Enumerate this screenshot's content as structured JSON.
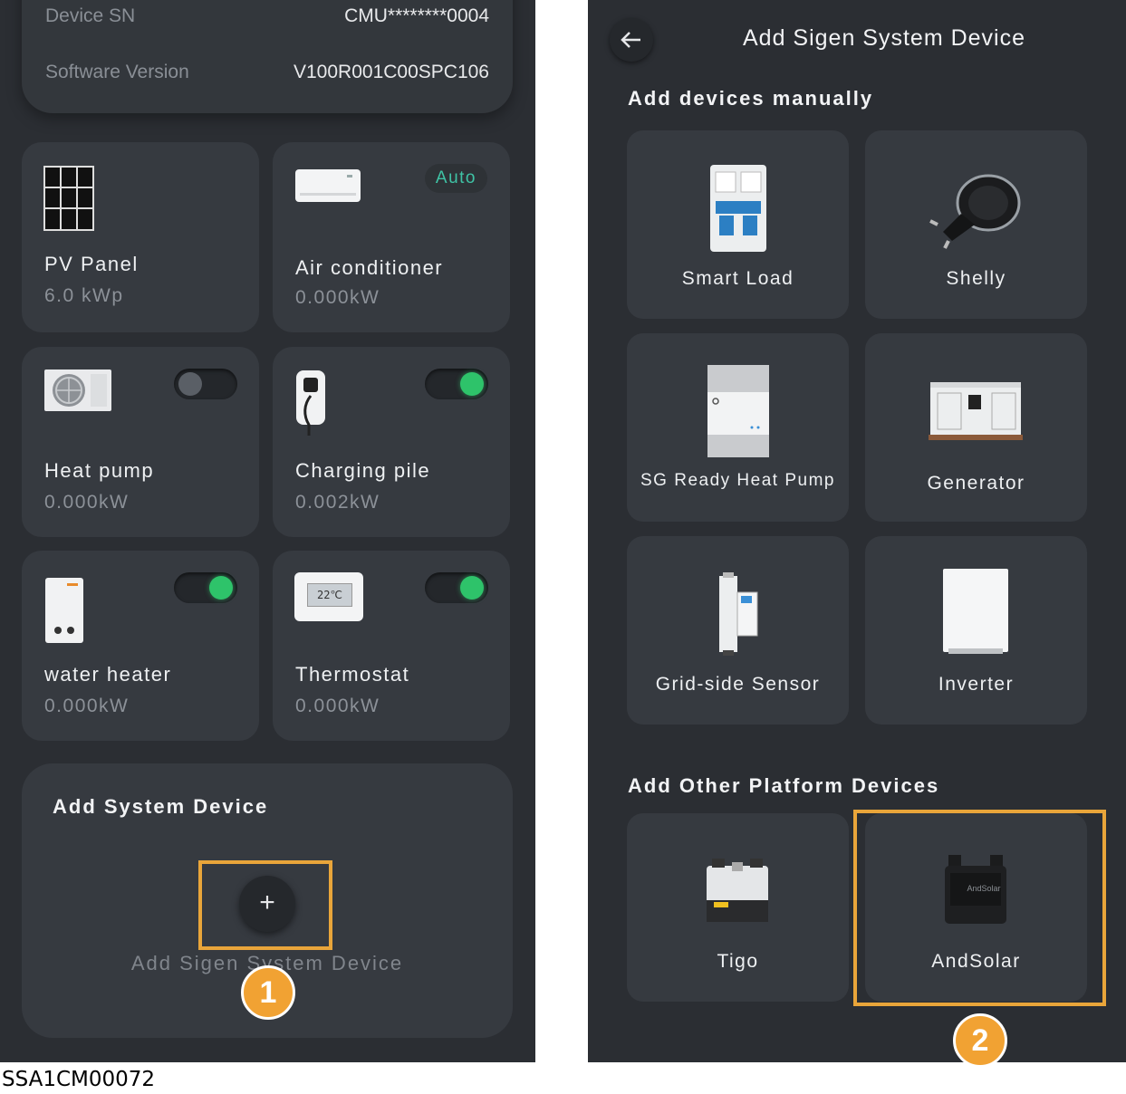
{
  "left_screen": {
    "info": {
      "device_sn_label": "Device SN",
      "device_sn_value": "CMU********0004",
      "software_version_label": "Software Version",
      "software_version_value": "V100R001C00SPC106"
    },
    "devices": [
      {
        "name": "PV Panel",
        "value": "6.0 kWp",
        "icon": "pv-panel-icon"
      },
      {
        "name": "Air conditioner",
        "value": "0.000kW",
        "icon": "air-conditioner-icon",
        "badge": "Auto"
      },
      {
        "name": "Heat pump",
        "value": "0.000kW",
        "icon": "heat-pump-icon",
        "toggle": false
      },
      {
        "name": "Charging pile",
        "value": "0.002kW",
        "icon": "charging-pile-icon",
        "toggle": true
      },
      {
        "name": "water heater",
        "value": "0.000kW",
        "icon": "water-heater-icon",
        "toggle": true
      },
      {
        "name": "Thermostat",
        "value": "0.000kW",
        "icon": "thermostat-icon",
        "toggle": true,
        "display": "22℃"
      }
    ],
    "add_section": {
      "title": "Add System Device",
      "button_symbol": "+",
      "button_label": "Add Sigen System Device"
    },
    "step_number": "1"
  },
  "right_screen": {
    "header_title": "Add Sigen System Device",
    "back_icon": "arrow-left-icon",
    "manual_title": "Add devices manually",
    "manual_devices": [
      {
        "label": "Smart Load",
        "icon": "smart-load-icon"
      },
      {
        "label": "Shelly",
        "icon": "shelly-plug-icon"
      },
      {
        "label": "SG Ready Heat Pump",
        "icon": "sg-ready-heat-pump-icon"
      },
      {
        "label": "Generator",
        "icon": "generator-icon"
      },
      {
        "label": "Grid-side Sensor",
        "icon": "grid-sensor-icon"
      },
      {
        "label": "Inverter",
        "icon": "inverter-icon"
      }
    ],
    "other_title": "Add Other Platform Devices",
    "other_devices": [
      {
        "label": "Tigo",
        "icon": "tigo-device-icon"
      },
      {
        "label": "AndSolar",
        "icon": "andsolar-device-icon",
        "logo_text": "AndSolar"
      }
    ],
    "step_number": "2"
  },
  "caption": "SSA1CM00072",
  "colors": {
    "background": "#2b2e33",
    "card": "#363a40",
    "toggle_on": "#2ec36a",
    "highlight": "#e9a53a",
    "badge_text": "#3fc3a5"
  }
}
